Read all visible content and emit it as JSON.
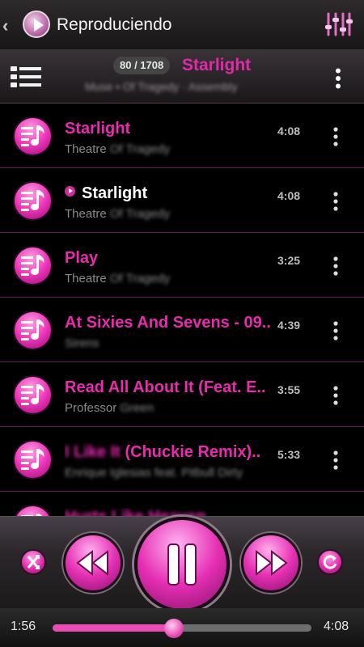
{
  "colors": {
    "accent": "#e02aa8",
    "active_text": "#ffffff",
    "divider": "#6a1d58"
  },
  "topbar": {
    "title": "Reproduciendo",
    "icons": [
      "back-chevron-icon",
      "app-play-icon",
      "equalizer-icon"
    ]
  },
  "now_playing": {
    "counter": "80 / 1708",
    "title": "Starlight",
    "subtitle": "Muse • Of Tragedy · Assembly"
  },
  "tracks": [
    {
      "title": "Starlight",
      "artist": "Theatre",
      "artist_hidden": "Of Tragedy",
      "duration": "4:08",
      "active": false
    },
    {
      "title": "Starlight",
      "artist": "Theatre",
      "artist_hidden": "Of Tragedy",
      "duration": "4:08",
      "active": true
    },
    {
      "title": "Play",
      "artist": "Theatre",
      "artist_hidden": "Of Tragedy",
      "duration": "3:25",
      "active": false
    },
    {
      "title": "At Sixies And Sevens - 09..",
      "artist": "",
      "artist_hidden": "Sirens",
      "duration": "4:39",
      "active": false
    },
    {
      "title": "Read All About It (Feat. E..",
      "artist": "Professor",
      "artist_hidden": "Green",
      "duration": "3:55",
      "active": false
    },
    {
      "title": "(Chuckie Remix)..",
      "title_hidden": "I Like It",
      "artist": "",
      "artist_hidden": "Enrique Iglesias feat. Pitbull Dirty",
      "duration": "5:33",
      "active": false
    },
    {
      "title": "",
      "title_hidden": "Hurts Like Heaven",
      "artist": "",
      "artist_hidden": "",
      "duration": "",
      "active": false
    }
  ],
  "playback": {
    "elapsed": "1:56",
    "total": "4:08",
    "progress_fraction": 0.468
  }
}
